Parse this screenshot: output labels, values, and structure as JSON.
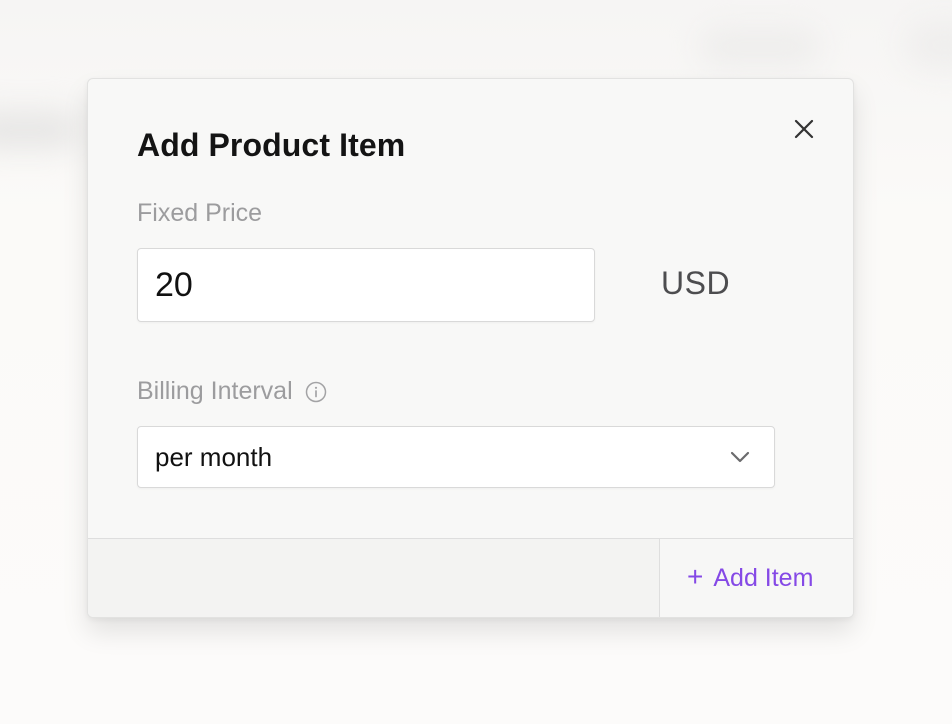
{
  "modal": {
    "title": "Add Product Item",
    "close_icon": "close-icon"
  },
  "fixed_price": {
    "label": "Fixed Price",
    "value": "20",
    "currency": "USD"
  },
  "billing_interval": {
    "label": "Billing Interval",
    "info_icon": "info-icon",
    "selected": "per month",
    "chevron_icon": "chevron-down-icon"
  },
  "footer": {
    "add_item_icon": "plus-icon",
    "add_item_label": "Add Item"
  },
  "colors": {
    "accent": "#8549e6",
    "title": "#141414",
    "label": "#9c9c9e",
    "border": "#d9d9d9"
  }
}
